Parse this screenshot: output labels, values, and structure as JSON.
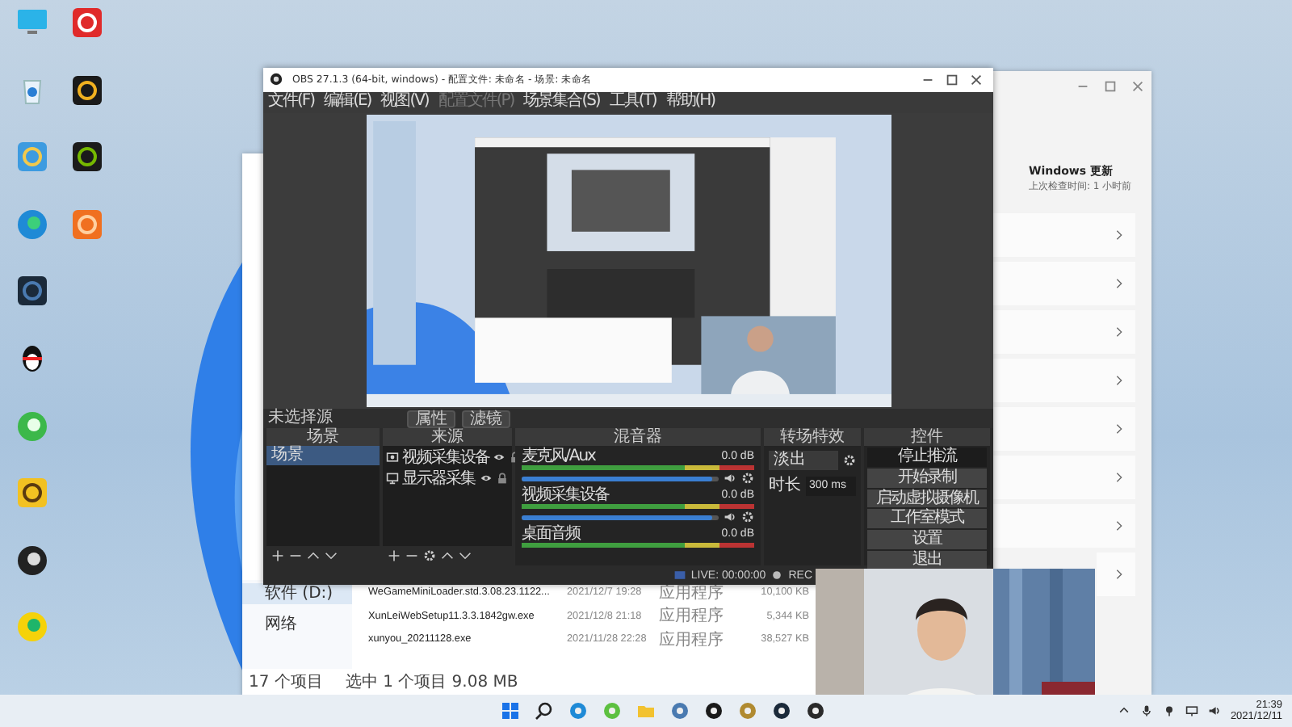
{
  "desktop_icons": [
    {
      "kind": "computer"
    },
    {
      "kind": "recycle"
    },
    {
      "kind": "panel"
    },
    {
      "kind": "edge"
    },
    {
      "kind": "studio"
    },
    {
      "kind": "qq"
    },
    {
      "kind": "green-browser"
    },
    {
      "kind": "owl"
    },
    {
      "kind": "obs"
    },
    {
      "kind": "music"
    },
    {
      "kind": "red-app"
    },
    {
      "kind": "dark-app"
    },
    {
      "kind": "nvidia"
    },
    {
      "kind": "orange-app"
    }
  ],
  "explorer": {
    "tree": [
      {
        "label": "软件 (D:)",
        "selected": true
      },
      {
        "label": "网络",
        "selected": false
      }
    ],
    "files": [
      {
        "name": "WeGameMiniLoader.std.3.08.23.1122...",
        "date": "2021/12/7 19:28",
        "type": "应用程序",
        "size": "10,100 KB"
      },
      {
        "name": "XunLeiWebSetup11.3.3.1842gw.exe",
        "date": "2021/12/8 21:18",
        "type": "应用程序",
        "size": "5,344 KB"
      },
      {
        "name": "xunyou_20211128.exe",
        "date": "2021/11/28 22:28",
        "type": "应用程序",
        "size": "38,527 KB"
      }
    ],
    "status": [
      "17 个项目",
      "选中 1 个项目 9.08 MB"
    ]
  },
  "settings": {
    "title": "Windows 更新",
    "subtitle": "上次检查时间: 1 小时前"
  },
  "obs": {
    "title": "OBS 27.1.3 (64-bit, windows) - 配置文件: 未命名 - 场景: 未命名",
    "menu": [
      {
        "label": "文件(F)",
        "disabled": false
      },
      {
        "label": "编辑(E)",
        "disabled": false
      },
      {
        "label": "视图(V)",
        "disabled": false
      },
      {
        "label": "配置文件(P)",
        "disabled": true
      },
      {
        "label": "场景集合(S)",
        "disabled": false
      },
      {
        "label": "工具(T)",
        "disabled": false
      },
      {
        "label": "帮助(H)",
        "disabled": false
      }
    ],
    "source_bar": {
      "label": "未选择源",
      "buttons": [
        "属性",
        "滤镜"
      ]
    },
    "scenes": {
      "title": "场景",
      "items": [
        {
          "label": "场景",
          "selected": true
        }
      ]
    },
    "sources": {
      "title": "来源",
      "items": [
        {
          "label": "视频采集设备",
          "kind": "camera"
        },
        {
          "label": "显示器采集",
          "kind": "monitor"
        }
      ]
    },
    "mixer": {
      "title": "混音器",
      "channels": [
        {
          "name": "麦克风/Aux",
          "reading": "0.0 dB",
          "level": 0.97
        },
        {
          "name": "视频采集设备",
          "reading": "0.0 dB",
          "level": 0.97
        },
        {
          "name": "桌面音频",
          "reading": "0.0 dB"
        }
      ]
    },
    "transitions": {
      "title": "转场特效",
      "selected": "淡出",
      "duration_label": "时长",
      "duration": "300 ms"
    },
    "controls": {
      "title": "控件",
      "buttons": [
        {
          "label": "停止推流",
          "active": true
        },
        {
          "label": "开始录制",
          "active": false
        },
        {
          "label": "启动虚拟摄像机",
          "active": false
        },
        {
          "label": "工作室模式",
          "active": false
        },
        {
          "label": "设置",
          "active": false
        },
        {
          "label": "退出",
          "active": false
        }
      ]
    },
    "status": {
      "live": "LIVE: 00:00:00",
      "rec": "REC"
    }
  },
  "taskbar": {
    "apps": [
      {
        "kind": "start"
      },
      {
        "kind": "search"
      },
      {
        "kind": "edge"
      },
      {
        "kind": "green"
      },
      {
        "kind": "folder"
      },
      {
        "kind": "gear"
      },
      {
        "kind": "dark-app"
      },
      {
        "kind": "gold"
      },
      {
        "kind": "studio"
      },
      {
        "kind": "obs"
      }
    ],
    "time": "21:39",
    "date": "2021/12/11"
  }
}
